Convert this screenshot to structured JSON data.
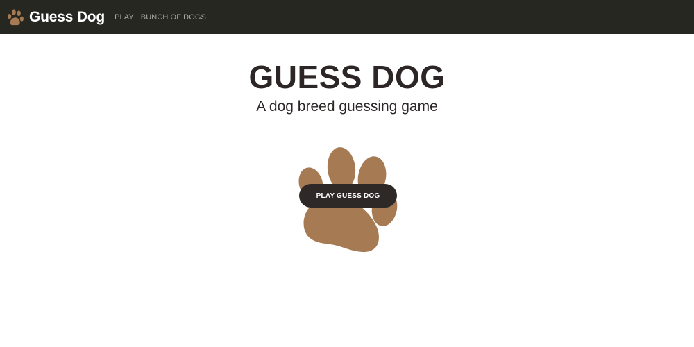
{
  "navbar": {
    "brand": "Guess Dog",
    "brand_icon": "paw-icon",
    "links": [
      {
        "label": "PLAY"
      },
      {
        "label": "BUNCH OF DOGS"
      }
    ]
  },
  "hero": {
    "title": "GUESS DOG",
    "subtitle": "A dog breed guessing game",
    "illustration": "paw-icon",
    "play_button": "PLAY GUESS DOG"
  },
  "colors": {
    "navbar_bg": "#272722",
    "paw": "#a67b53",
    "text_dark": "#2c2626",
    "button_bg": "#2e2827"
  }
}
